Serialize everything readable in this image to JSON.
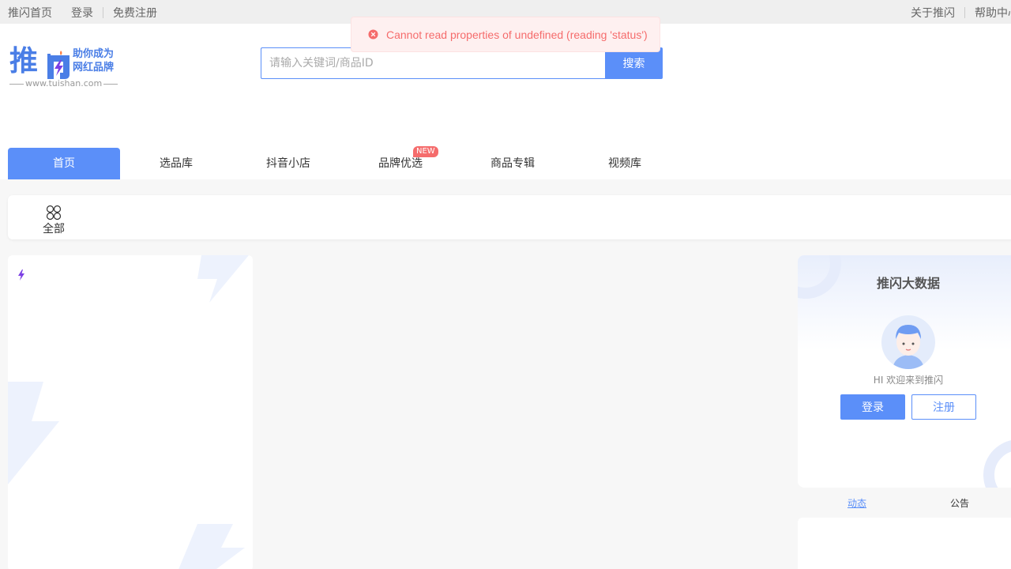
{
  "topbar": {
    "home": "推闪首页",
    "login": "登录",
    "register": "免费注册",
    "about": "关于推闪",
    "help": "帮助中心"
  },
  "logo": {
    "brand": "推闪",
    "slogan_line1": "助你成为",
    "slogan_line2": "网红品牌",
    "url": "www.tuishan.com"
  },
  "search": {
    "placeholder": "请输入关键词/商品ID",
    "button": "搜索"
  },
  "nav": {
    "items": [
      {
        "label": "首页",
        "active": true
      },
      {
        "label": "选品库"
      },
      {
        "label": "抖音小店"
      },
      {
        "label": "品牌优选",
        "badge": "NEW"
      },
      {
        "label": "商品专辑"
      },
      {
        "label": "视频库"
      }
    ]
  },
  "categories": {
    "all": "全部"
  },
  "sidebar": {
    "title": "推闪大数据",
    "welcome": "HI 欢迎来到推闪",
    "login_button": "登录",
    "register_button": "注册",
    "tabs": [
      "动态",
      "公告"
    ]
  },
  "toast": {
    "message": "Cannot read properties of undefined (reading 'status')"
  },
  "colors": {
    "accent": "#5b8ff9",
    "error": "#f56c6c",
    "badge": "#f56c6c"
  }
}
